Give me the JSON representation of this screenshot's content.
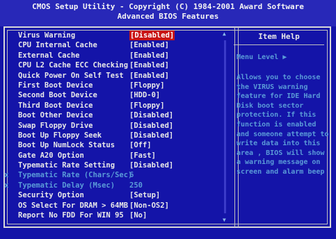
{
  "header": {
    "title_line1": "CMOS Setup Utility - Copyright (C) 1984-2001 Award Software",
    "title_line2": "Advanced BIOS Features"
  },
  "settings": [
    {
      "label": "Virus Warning",
      "value": "[Disabled]",
      "selected": true
    },
    {
      "label": "CPU Internal Cache",
      "value": "[Enabled]"
    },
    {
      "label": "External Cache",
      "value": "[Enabled]"
    },
    {
      "label": "CPU L2 Cache ECC Checking",
      "value": "[Enabled]"
    },
    {
      "label": "Quick Power On Self Test",
      "value": "[Enabled]"
    },
    {
      "label": "First Boot Device",
      "value": "[Floppy]"
    },
    {
      "label": "Second Boot Device",
      "value": "[HDD-0]"
    },
    {
      "label": "Third Boot Device",
      "value": "[Floppy]"
    },
    {
      "label": "Boot Other Device",
      "value": "[Disabled]"
    },
    {
      "label": "Swap Floppy Drive",
      "value": "[Disabled]"
    },
    {
      "label": "Boot Up Floppy Seek",
      "value": "[Disabled]"
    },
    {
      "label": "Boot Up NumLock Status",
      "value": "[Off]"
    },
    {
      "label": "Gate A20 Option",
      "value": "[Fast]"
    },
    {
      "label": "Typematic Rate Setting",
      "value": "[Disabled]"
    },
    {
      "label": "Typematic Rate (Chars/Sec)",
      "value": "6",
      "dim": true,
      "mark": "x"
    },
    {
      "label": "Typematic Delay (Msec)",
      "value": "250",
      "dim": true,
      "mark": "x"
    },
    {
      "label": "Security Option",
      "value": "[Setup]"
    },
    {
      "label": "OS Select For DRAM > 64MB",
      "value": "[Non-OS2]"
    },
    {
      "label": "Report No FDD For WIN 95",
      "value": "[No]"
    }
  ],
  "help": {
    "title": "Item Help",
    "menu_level": "Menu Level   ▶",
    "text": "Allows you to choose the VIRUS warning feature for IDE Hard Disk boot sector protection. If this function is enabled and someone attempt to write data into this area , BIOS will show a warning message on screen and alarm beep"
  },
  "scrollbar": {
    "up": "▲",
    "down": "▼"
  }
}
